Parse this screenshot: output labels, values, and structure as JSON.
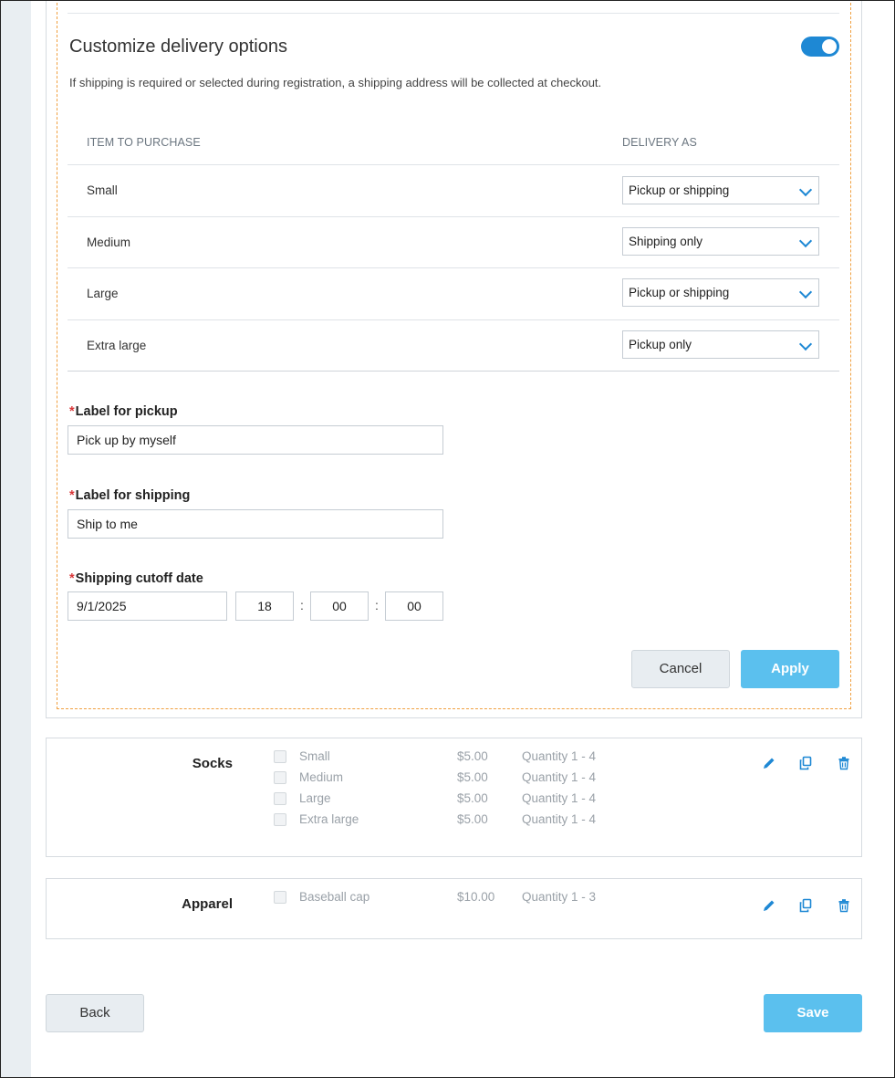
{
  "delivery": {
    "title": "Customize delivery options",
    "toggle_on": true,
    "description": "If shipping is required or selected during registration, a shipping address will be collected at checkout.",
    "col_item": "ITEM TO PURCHASE",
    "col_delivery": "DELIVERY AS",
    "rows": [
      {
        "item": "Small",
        "delivery": "Pickup or shipping"
      },
      {
        "item": "Medium",
        "delivery": "Shipping only"
      },
      {
        "item": "Large",
        "delivery": "Pickup or shipping"
      },
      {
        "item": "Extra large",
        "delivery": "Pickup only"
      }
    ],
    "required_mark": "*",
    "pickup_label": "Label for pickup",
    "pickup_value": "Pick up by myself",
    "shipping_label": "Label for shipping",
    "shipping_value": "Ship to me",
    "cutoff_label": "Shipping cutoff date",
    "cutoff_date": "9/1/2025",
    "cutoff_hour": "18",
    "cutoff_minute": "00",
    "cutoff_second": "00",
    "colon": ":",
    "cancel_label": "Cancel",
    "apply_label": "Apply"
  },
  "products": [
    {
      "name": "Socks",
      "variants": [
        {
          "name": "Small",
          "price": "$5.00",
          "qty": "Quantity 1 - 4"
        },
        {
          "name": "Medium",
          "price": "$5.00",
          "qty": "Quantity 1 - 4"
        },
        {
          "name": "Large",
          "price": "$5.00",
          "qty": "Quantity 1 - 4"
        },
        {
          "name": "Extra large",
          "price": "$5.00",
          "qty": "Quantity 1 - 4"
        }
      ]
    },
    {
      "name": "Apparel",
      "variants": [
        {
          "name": "Baseball cap",
          "price": "$10.00",
          "qty": "Quantity 1 - 3"
        }
      ]
    }
  ],
  "footer": {
    "back_label": "Back",
    "save_label": "Save"
  },
  "icons": {
    "edit": "pencil-icon",
    "copy": "copy-icon",
    "delete": "trash-icon"
  },
  "colors": {
    "accent": "#1e88d4",
    "primary_button": "#5bc0ee",
    "required": "#d9383a",
    "dashed_border": "#f0a040"
  }
}
